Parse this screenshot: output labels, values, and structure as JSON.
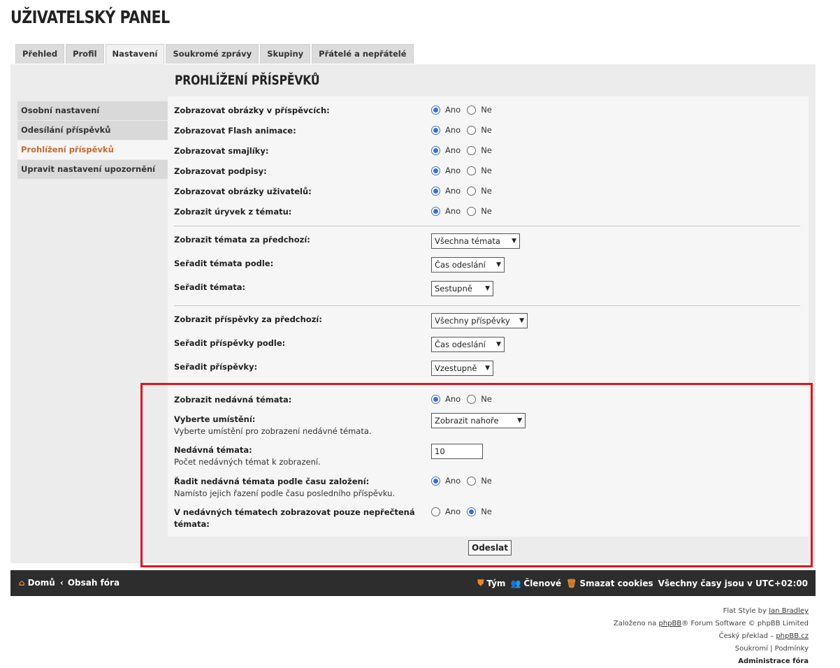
{
  "page": {
    "title": "UŽIVATELSKÝ PANEL"
  },
  "tabs": [
    {
      "label": "Přehled"
    },
    {
      "label": "Profil"
    },
    {
      "label": "Nastavení"
    },
    {
      "label": "Soukromé zprávy"
    },
    {
      "label": "Skupiny"
    },
    {
      "label": "Přátelé a nepřátelé"
    }
  ],
  "sidebar": {
    "items": [
      {
        "label": "Osobní nastavení"
      },
      {
        "label": "Odesílání příspěvků"
      },
      {
        "label": "Prohlížení příspěvků"
      },
      {
        "label": "Upravit nastavení upozornění"
      }
    ]
  },
  "section": {
    "title": "PROHLÍŽENÍ PŘÍSPĚVKŮ"
  },
  "radio": {
    "yes": "Ano",
    "no": "Ne"
  },
  "display": {
    "images": {
      "label": "Zobrazovat obrázky v příspěvcích:",
      "value": "Ano"
    },
    "flash": {
      "label": "Zobrazovat Flash animace:",
      "value": "Ano"
    },
    "smilies": {
      "label": "Zobrazovat smajlíky:",
      "value": "Ano"
    },
    "signatures": {
      "label": "Zobrazovat podpisy:",
      "value": "Ano"
    },
    "avatars": {
      "label": "Zobrazovat obrázky uživatelů:",
      "value": "Ano"
    },
    "excerpt": {
      "label": "Zobrazit úryvek z tématu:",
      "value": "Ano"
    }
  },
  "topics": {
    "days": {
      "label": "Zobrazit témata za předchozí:",
      "value": "Všechna témata"
    },
    "sortby": {
      "label": "Seřadit témata podle:",
      "value": "Čas odeslání"
    },
    "order": {
      "label": "Seřadit témata:",
      "value": "Sestupně"
    }
  },
  "posts": {
    "days": {
      "label": "Zobrazit příspěvky za předchozí:",
      "value": "Všechny příspěvky"
    },
    "sortby": {
      "label": "Seřadit příspěvky podle:",
      "value": "Čas odeslání"
    },
    "order": {
      "label": "Seřadit příspěvky:",
      "value": "Vzestupně"
    }
  },
  "recent": {
    "show": {
      "label": "Zobrazit nedávná témata:",
      "value": "Ano"
    },
    "location": {
      "label": "Vyberte umístění:",
      "desc": "Vyberte umístění pro zobrazení nedávné témata.",
      "value": "Zobrazit nahoře"
    },
    "count": {
      "label": "Nedávná témata:",
      "desc": "Počet nedávných témat k zobrazení.",
      "value": "10"
    },
    "sort": {
      "label": "Řadit nedávná témata podle času založení:",
      "desc": "Namísto jejich řazení podle času posledního příspěvku.",
      "value": "Ano"
    },
    "unread": {
      "label": "V nedávných tématech zobrazovat pouze nepřečtená témata:",
      "value": "Ne"
    }
  },
  "submit_label": "Odeslat",
  "footer": {
    "home": "Domů",
    "index": "Obsah fóra",
    "team": "Tým",
    "members": "Členové",
    "cookies": "Smazat cookies",
    "timezone": "Všechny časy jsou v UTC+02:00"
  },
  "credits": {
    "style_prefix": "Flat Style by",
    "style_author": "Ian Bradley",
    "powered_prefix": "Založeno na",
    "powered_link": "phpBB",
    "powered_suffix": "® Forum Software © phpBB Limited",
    "translation_prefix": "Český překlad –",
    "translation_link": "phpBB.cz",
    "privacy": "Soukromí",
    "terms": "Podmínky",
    "admin": "Administrace fóra"
  },
  "colors": {
    "accent": "#c8682c",
    "radio": "#3a6fd8",
    "highlight": "#e0141e",
    "footer_bg": "#2d2d2d",
    "footer_icon": "#e8862e"
  }
}
